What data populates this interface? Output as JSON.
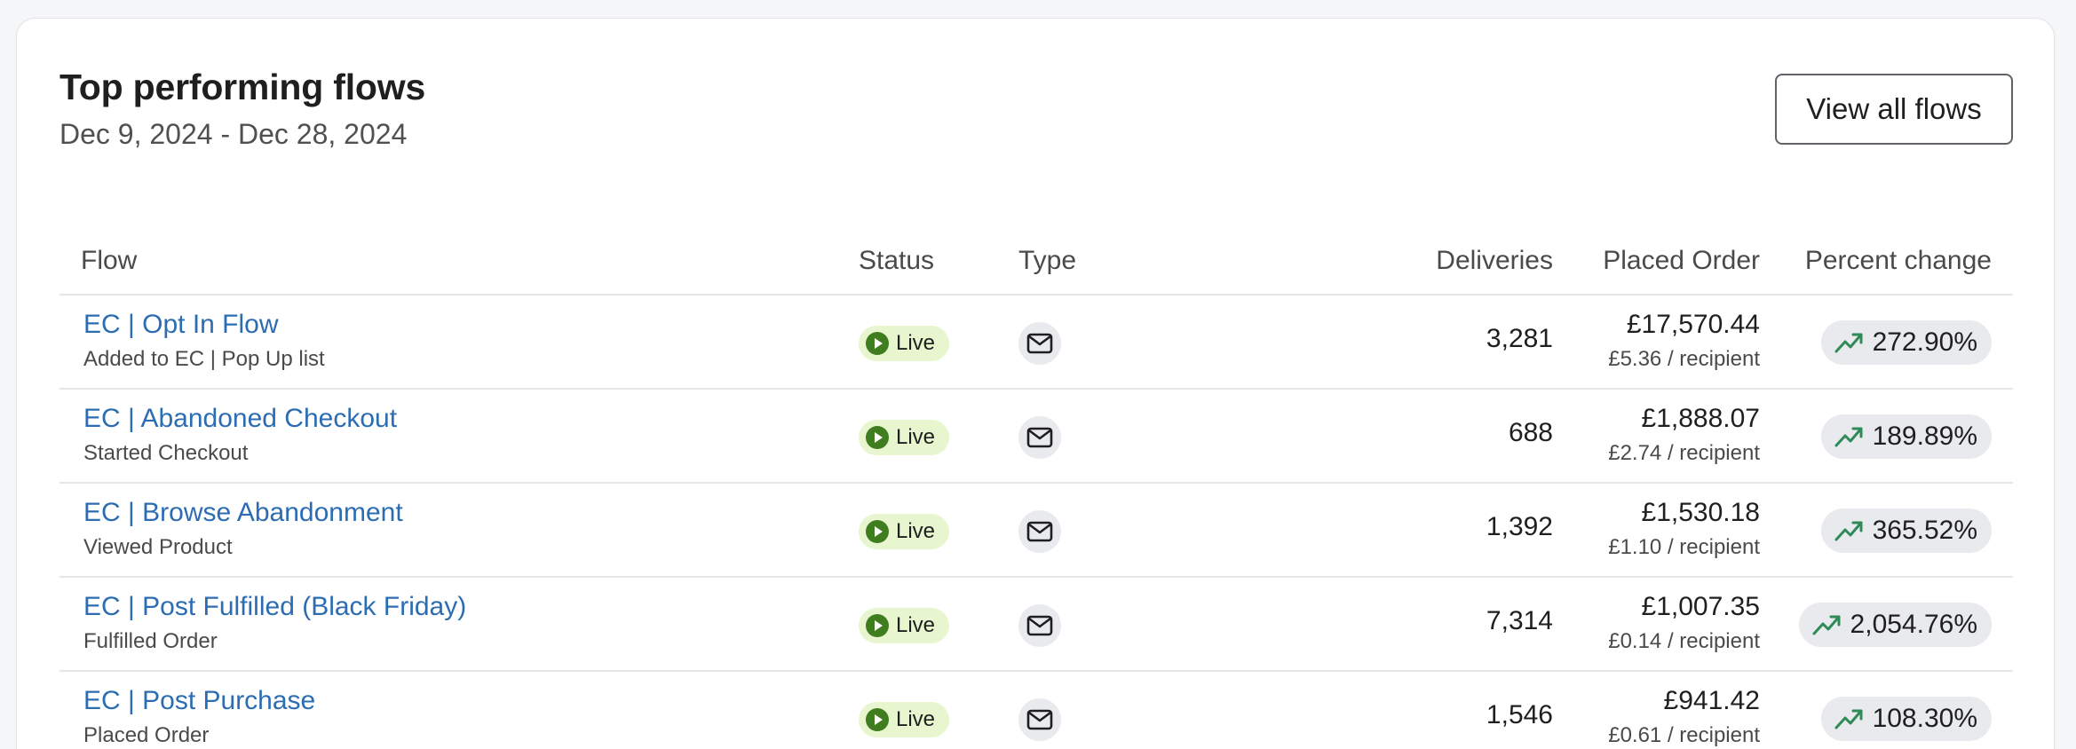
{
  "header": {
    "title": "Top performing flows",
    "date_range": "Dec 9, 2024 - Dec 28, 2024",
    "view_all_label": "View all flows"
  },
  "columns": {
    "flow": "Flow",
    "status": "Status",
    "type": "Type",
    "deliveries": "Deliveries",
    "placed_order": "Placed Order",
    "percent_change": "Percent change"
  },
  "rows": [
    {
      "name": "EC | Opt In Flow",
      "trigger": "Added to EC | Pop Up list",
      "status": "Live",
      "type_icon": "envelope-icon",
      "deliveries": "3,281",
      "placed_order": "£17,570.44",
      "per_recipient": "£5.36 / recipient",
      "percent_change": "272.90%"
    },
    {
      "name": "EC | Abandoned Checkout",
      "trigger": "Started Checkout",
      "status": "Live",
      "type_icon": "envelope-icon",
      "deliveries": "688",
      "placed_order": "£1,888.07",
      "per_recipient": "£2.74 / recipient",
      "percent_change": "189.89%"
    },
    {
      "name": "EC | Browse Abandonment",
      "trigger": "Viewed Product",
      "status": "Live",
      "type_icon": "envelope-icon",
      "deliveries": "1,392",
      "placed_order": "£1,530.18",
      "per_recipient": "£1.10 / recipient",
      "percent_change": "365.52%"
    },
    {
      "name": "EC | Post Fulfilled (Black Friday)",
      "trigger": "Fulfilled Order",
      "status": "Live",
      "type_icon": "envelope-icon",
      "deliveries": "7,314",
      "placed_order": "£1,007.35",
      "per_recipient": "£0.14 / recipient",
      "percent_change": "2,054.76%"
    },
    {
      "name": "EC | Post Purchase",
      "trigger": "Placed Order",
      "status": "Live",
      "type_icon": "envelope-icon",
      "deliveries": "1,546",
      "placed_order": "£941.42",
      "per_recipient": "£0.61 / recipient",
      "percent_change": "108.30%"
    }
  ],
  "colors": {
    "link": "#2c6cb3",
    "live_badge_bg": "#e7f6cf",
    "live_icon": "#3f7d1e",
    "trend_up": "#2e8b57",
    "badge_bg": "#e8eaed"
  }
}
